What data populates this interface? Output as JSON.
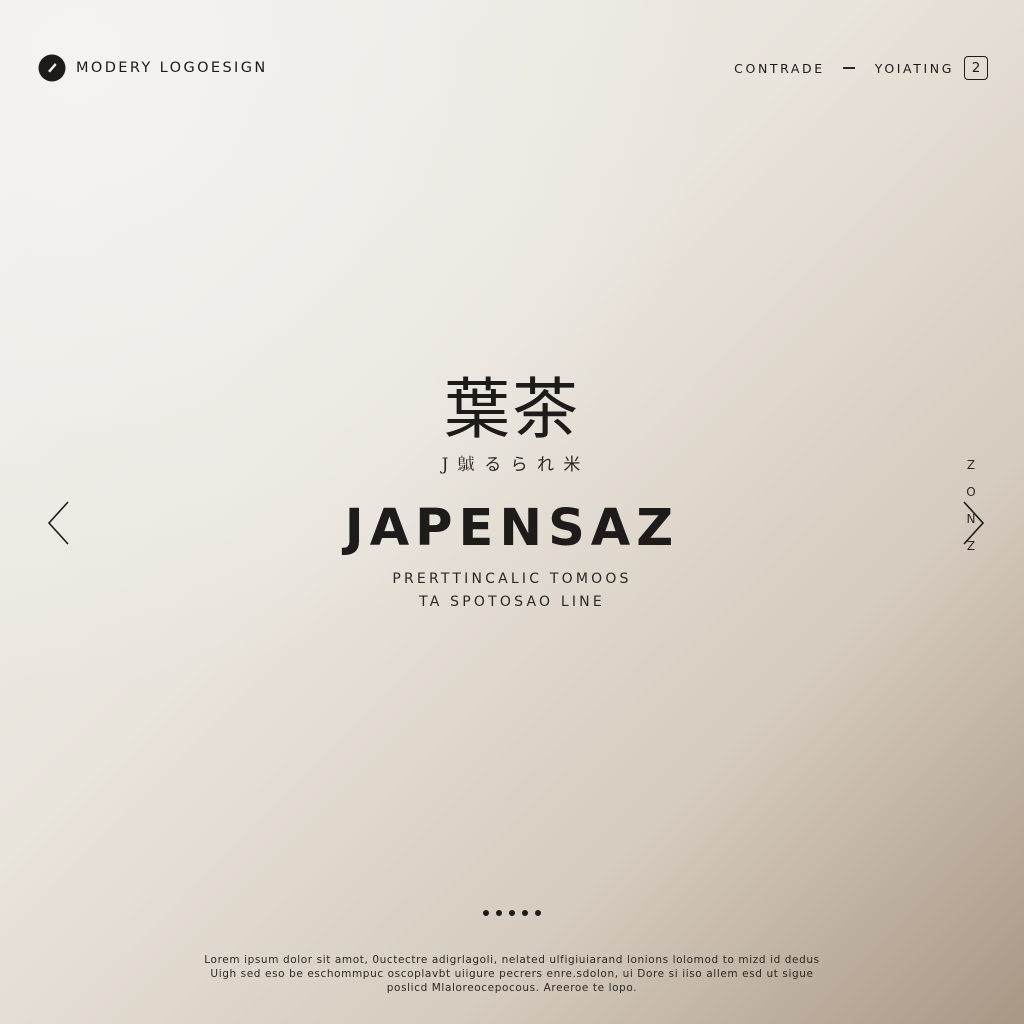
{
  "header": {
    "brand_text": "MODERY LOGOESIGN",
    "brand_icon": "logo-mark-icon",
    "nav_link_1": "CONTRADE",
    "nav_link_2": "YOIATING",
    "page_number": "2"
  },
  "hero": {
    "kanji": "葉茶",
    "kana": "J 𩿠 る ら れ 米",
    "title": "JAPENSAZ",
    "subtitle_line1": "PRERTTINCALIC TOMOOS",
    "subtitle_line2": "TA SPOTOSAO LINE"
  },
  "side_label": [
    "Z",
    "O",
    "N",
    "Z"
  ],
  "arrows": {
    "left_icon": "chevron-left-icon",
    "right_icon": "chevron-right-icon"
  },
  "pagination": {
    "dot_count": 5
  },
  "footer": {
    "line1": "Lorem ipsum dolor sit amot, 0uctectre adigrlagoli, nelated ulfigiuiarand lonions lolomod to mizd id dedus",
    "line2": "Uigh sed eso be eschommpuc oscoplavbt uiigure pecrers enre.sdolon, ui Dore si iiso allem esd ut sigue",
    "line3": "poslicd Mlaloreocepocous. Areeroe te lopo."
  },
  "colors": {
    "text": "#1c1b19",
    "background_light": "#f1efeb",
    "background_dark": "#a99785"
  }
}
